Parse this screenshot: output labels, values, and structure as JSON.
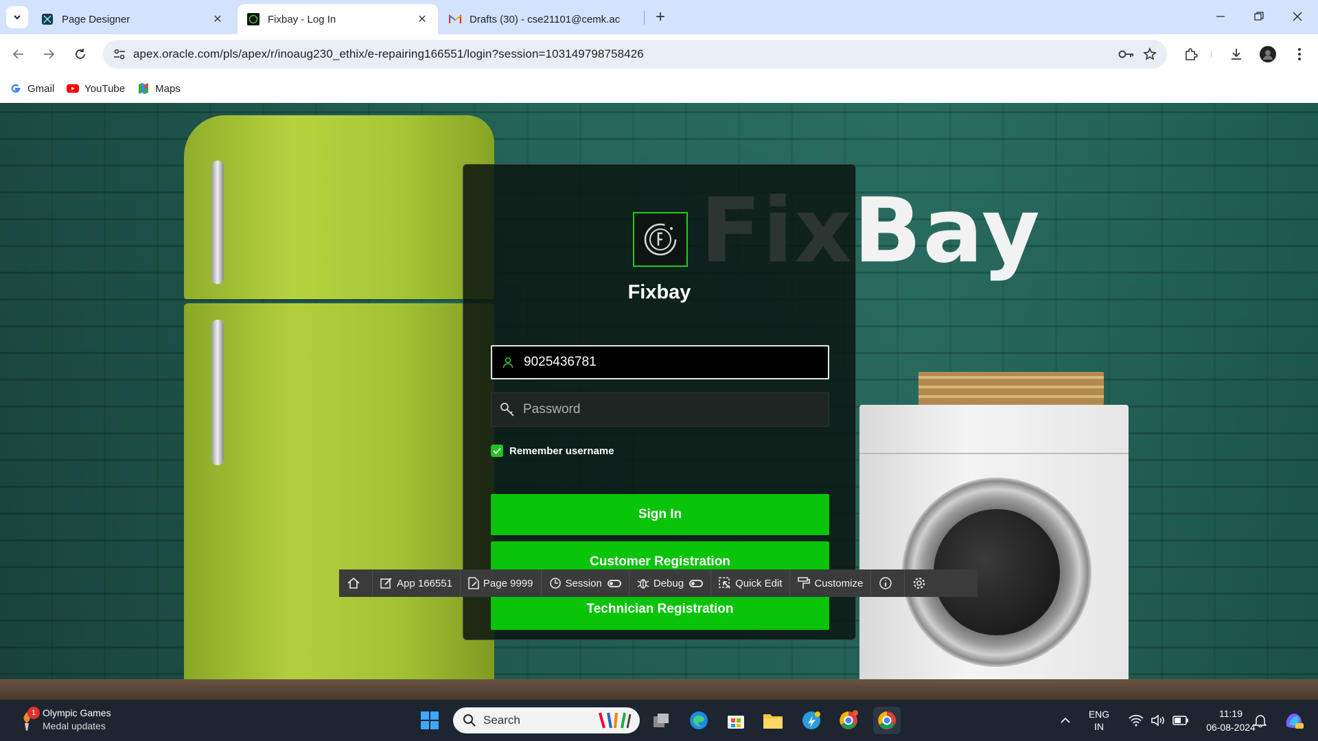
{
  "browser": {
    "tabs": [
      {
        "label": "Page Designer",
        "active": false
      },
      {
        "label": "Fixbay - Log In",
        "active": true
      },
      {
        "label": "Drafts (30) - cse21101@cemk.ac",
        "active": false
      }
    ],
    "url": "apex.oracle.com/pls/apex/r/inoaug230_ethix/e-repairing166551/login?session=103149798758426",
    "bookmarks": [
      {
        "label": "Gmail",
        "icon": "google-icon"
      },
      {
        "label": "YouTube",
        "icon": "youtube-icon"
      },
      {
        "label": "Maps",
        "icon": "maps-icon"
      }
    ]
  },
  "background": {
    "logo_text": "FixBay"
  },
  "login": {
    "app_name": "Fixbay",
    "username_value": "9025436781",
    "password_placeholder": "Password",
    "remember_label": "Remember username",
    "remember_checked": true,
    "sign_in_label": "Sign In",
    "customer_registration_label": "Customer Registration",
    "technician_registration_label": "Technician Registration",
    "accent_color": "#0ac40a"
  },
  "devbar": {
    "app": "App 166551",
    "page": "Page 9999",
    "session": "Session",
    "debug": "Debug",
    "quick_edit": "Quick Edit",
    "customize": "Customize"
  },
  "taskbar": {
    "widget_title": "Olympic Games",
    "widget_subtitle": "Medal updates",
    "widget_badge": "1",
    "search_placeholder": "Search",
    "lang_line1": "ENG",
    "lang_line2": "IN",
    "time": "11:19",
    "date": "06-08-2024"
  }
}
